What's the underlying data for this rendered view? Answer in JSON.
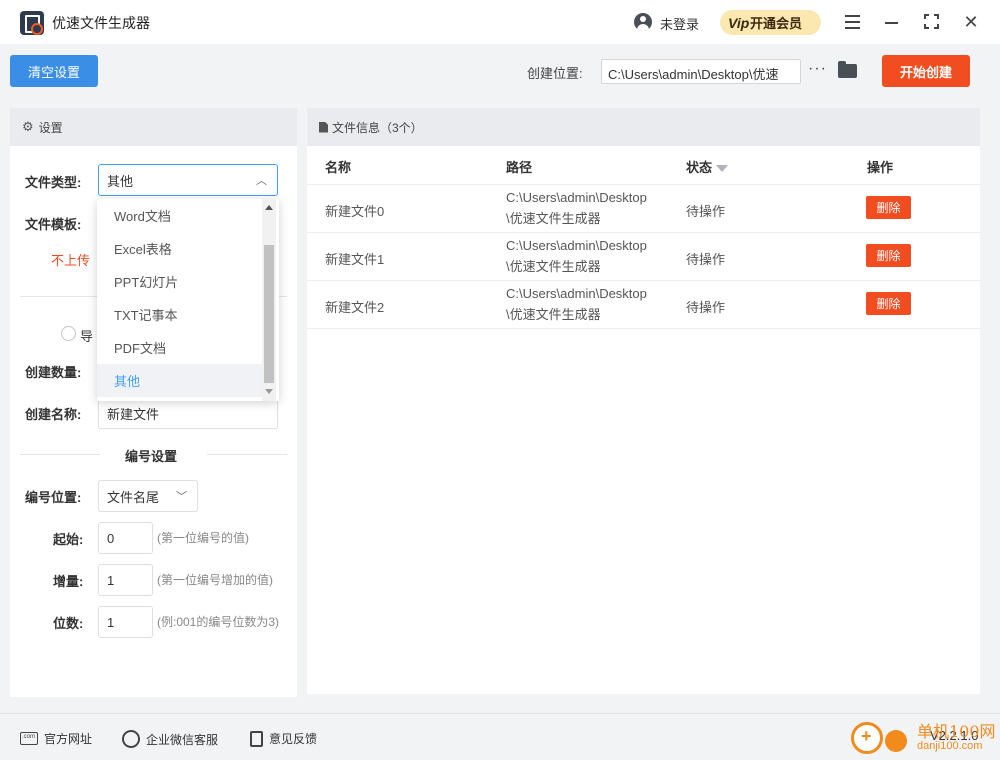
{
  "app": {
    "title": "优速文件生成器"
  },
  "header": {
    "login_text": "未登录",
    "vip_label": "开通会员",
    "vip_badge": "Vip",
    "close_glyph": "✕"
  },
  "toolbar": {
    "clear_label": "清空设置",
    "location_label": "创建位置:",
    "location_value": "C:\\Users\\admin\\Desktop\\优速",
    "more_glyph": "···",
    "start_label": "开始创建"
  },
  "settings": {
    "header_label": "设置",
    "gear_glyph": "⚙",
    "file_type_label": "文件类型:",
    "file_type_value": "其他",
    "file_template_label": "文件模板:",
    "no_upload_note": "不上传",
    "import_label_partial": "导",
    "create_count_label": "创建数量:",
    "create_name_label": "创建名称:",
    "create_name_value": "新建文件",
    "numbering_title": "编号设置",
    "number_position_label": "编号位置:",
    "number_position_value": "文件名尾",
    "start_label": "起始:",
    "start_value": "0",
    "start_hint": "(第一位编号的值)",
    "increment_label": "增量:",
    "increment_value": "1",
    "increment_hint": "(第一位编号增加的值)",
    "digits_label": "位数:",
    "digits_value": "1",
    "digits_hint": "(例:001的编号位数为3)"
  },
  "dropdown": {
    "options": [
      "Word文档",
      "Excel表格",
      "PPT幻灯片",
      "TXT记事本",
      "PDF文档",
      "其他"
    ],
    "selected": "其他"
  },
  "file_info": {
    "header_label": "文件信息（3个）",
    "columns": [
      "名称",
      "路径",
      "状态",
      "操作"
    ],
    "rows": [
      {
        "name": "新建文件0",
        "path": "C:\\Users\\admin\\Desktop\\优速文件生成器",
        "status": "待操作",
        "action": "删除"
      },
      {
        "name": "新建文件1",
        "path": "C:\\Users\\admin\\Desktop\\优速文件生成器",
        "status": "待操作",
        "action": "删除"
      },
      {
        "name": "新建文件2",
        "path": "C:\\Users\\admin\\Desktop\\优速文件生成器",
        "status": "待操作",
        "action": "删除"
      }
    ]
  },
  "footer": {
    "website": "官方网址",
    "wechat_service": "企业微信客服",
    "feedback": "意见反馈",
    "version": "V2.2.1.0",
    "watermark_cn": "单机100网",
    "watermark_url": "danji100.com"
  },
  "colors": {
    "primary_blue": "#3a8ee6",
    "accent_red": "#f24d21",
    "vip_gold": "#fbe7b0"
  }
}
